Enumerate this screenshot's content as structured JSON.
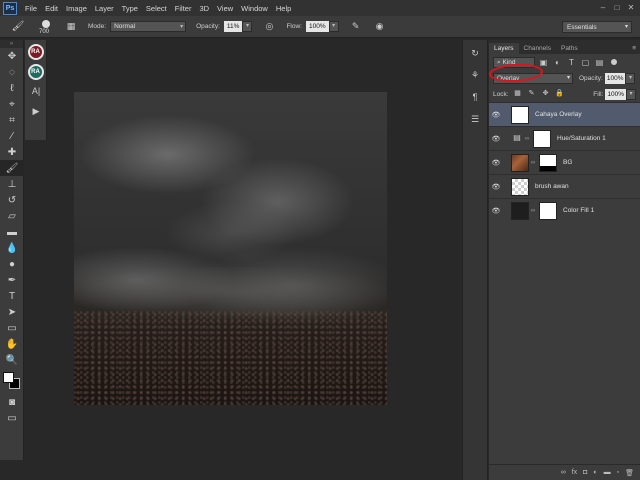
{
  "app": {
    "logo": "Ps"
  },
  "menu": [
    "File",
    "Edit",
    "Image",
    "Layer",
    "Type",
    "Select",
    "Filter",
    "3D",
    "View",
    "Window",
    "Help"
  ],
  "window_controls": [
    "–",
    "□",
    "✕"
  ],
  "options": {
    "brush_size": "700",
    "mode_label": "Mode:",
    "mode_value": "Normal",
    "opacity_label": "Opacity:",
    "opacity_value": "11%",
    "flow_label": "Flow:",
    "flow_value": "100%",
    "workspace": "Essentials"
  },
  "side_panel": {
    "badge1": "RA",
    "badge2": "RA"
  },
  "layers_panel": {
    "tabs": [
      "Layers",
      "Channels",
      "Paths"
    ],
    "kind_label": "Kind",
    "blend_mode": "Overlay",
    "opacity_label": "Opacity:",
    "opacity_value": "100%",
    "lock_label": "Lock:",
    "fill_label": "Fill:",
    "fill_value": "100%",
    "layers": [
      {
        "name": "Cahaya Overlay",
        "selected": true
      },
      {
        "name": "Hue/Saturation 1",
        "selected": false
      },
      {
        "name": "BG",
        "selected": false
      },
      {
        "name": "brush awan",
        "selected": false
      },
      {
        "name": "Color Fill 1",
        "selected": false
      }
    ],
    "footer_icons": [
      "link-layers-icon",
      "fx-icon",
      "add-mask-icon",
      "adjustment-icon",
      "new-group-icon",
      "new-layer-icon",
      "delete-icon"
    ]
  },
  "colors": {
    "accent_ring": "#e0131a",
    "selected_layer": "#525b6e"
  }
}
